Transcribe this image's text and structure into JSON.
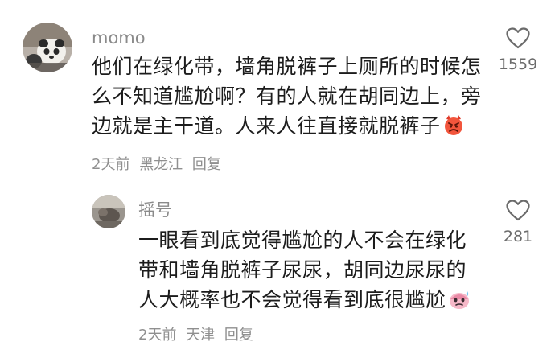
{
  "comments": [
    {
      "username": "momo",
      "avatar_icon": "panda-avatar",
      "lines": [
        "他们在绿化带，墙角脱裤子上厕所的时候怎",
        "么不知道尴尬啊？有的人就在胡同边上，旁",
        "边就是主干道。人来人往直接就脱裤子"
      ],
      "emoji": "angry-devil-emoji",
      "time": "2天前",
      "location": "黑龙江",
      "reply_label": "回复",
      "like_count": "1559",
      "like_icon": "heart-outline-icon"
    },
    {
      "username": "摇号",
      "avatar_icon": "photo-avatar",
      "lines": [
        "一眼看到底觉得尴尬的人不会在绿化",
        "带和墙角脱裤子尿尿，胡同边尿尿的",
        "人大概率也不会觉得看到底很尴尬"
      ],
      "emoji": "sweat-face-emoji",
      "time": "2天前",
      "location": "天津",
      "reply_label": "回复",
      "like_count": "281",
      "like_icon": "heart-outline-icon"
    }
  ],
  "colors": {
    "text": "#1c1c1c",
    "muted": "#8f8f8f",
    "username": "#8a8a8a"
  }
}
